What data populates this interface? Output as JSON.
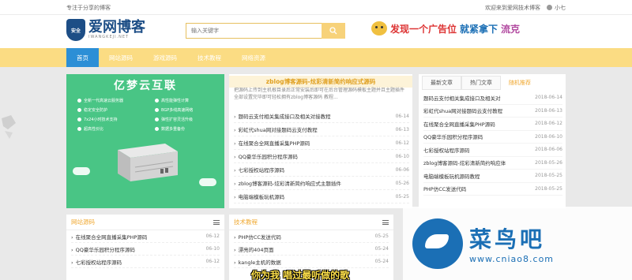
{
  "topbar": {
    "tagline": "专注于分享的博客",
    "welcome": "欢迎来到爱网技术博客",
    "user": "小七"
  },
  "logo": {
    "badge": "安全",
    "name": "爱网博客",
    "sub": "IWANGKEJI.NET"
  },
  "search": {
    "placeholder": "输入关键字"
  },
  "ad": {
    "text1": "发现一个广告位",
    "text2": "就紧拿下",
    "text3": "流克"
  },
  "nav": [
    {
      "label": "首页",
      "active": true
    },
    {
      "label": "网站源码",
      "active": false
    },
    {
      "label": "游戏源码",
      "active": false
    },
    {
      "label": "技术教程",
      "active": false
    },
    {
      "label": "网络资源",
      "active": false
    }
  ],
  "banner": {
    "title": "亿梦云互联",
    "features": [
      "全新一代高速云服务器",
      "高性能弹性计算",
      "稳定安全防护",
      "BGP多线高速网络",
      "7x24小时技术支持",
      "弹性扩容灵活升级",
      "超高性价比",
      "数据多重备份"
    ]
  },
  "center": {
    "headline": "zblog博客源码-炫彩清新简约响应式源码",
    "summary": "把源码上传到主机根目录后正常安装后即可在后台管理源码模板主题并且主题插件全部设置完毕即可轻松拥有zblog博客源码 教程...",
    "items": [
      {
        "title": "题码云支付相关集成接口及相关对接教程",
        "date": "06-14"
      },
      {
        "title": "彩虹代shua网对接题码云支付教程",
        "date": "06-13"
      },
      {
        "title": "在线聚合全网直播采集PHP源码",
        "date": "06-12"
      },
      {
        "title": "QQ豪华乐园积分程序源码",
        "date": "06-10"
      },
      {
        "title": "七彩授权站程序源码",
        "date": "06-06"
      },
      {
        "title": "zblog博客源码-炫彩清新简约响应式主题插件",
        "date": "05-26"
      },
      {
        "title": "电脑端模板玩机源码",
        "date": "05-25"
      }
    ]
  },
  "side": {
    "tabs": [
      "最新文章",
      "热门文章",
      "随机推荐"
    ],
    "items": [
      {
        "title": "题码云支付相关集成接口及相关对",
        "date": "2018-06-14"
      },
      {
        "title": "彩虹代shua网对接题码云支付教程",
        "date": "2018-06-13"
      },
      {
        "title": "在线聚合全网直播采集PHP源码",
        "date": "2018-06-12"
      },
      {
        "title": "QQ豪华乐园积分程序源码",
        "date": "2018-06-10"
      },
      {
        "title": "七彩授权站程序源码",
        "date": "2018-06-06"
      },
      {
        "title": "zblog博客源码-炫彩清新简约响应体",
        "date": "2018-05-26"
      },
      {
        "title": "电脑端模板玩机源码教程",
        "date": "2018-05-25"
      },
      {
        "title": "PHP仿CC发送代码",
        "date": "2018-05-25"
      }
    ]
  },
  "boxes": [
    {
      "title": "网站源码",
      "items": [
        {
          "title": "在线聚合全网直播采集PHP源码",
          "date": "06-12"
        },
        {
          "title": "QQ豪华乐园积分程序源码",
          "date": "06-10"
        },
        {
          "title": "七彩授权站程序源码",
          "date": "06-12"
        }
      ]
    },
    {
      "title": "技术教程",
      "items": [
        {
          "title": "PHP仿CC发送代码",
          "date": "05-25"
        },
        {
          "title": "漂亮的404页面",
          "date": "05-24"
        },
        {
          "title": "kangle主机的数据",
          "date": "05-24"
        }
      ]
    }
  ],
  "watermark": {
    "title": "菜鸟吧",
    "url": "www.cniao8.com"
  },
  "subtitle": "你为我 唱过最听做的歌",
  "colors": {
    "nav": "#fbdc83",
    "active": "#2c8fd6",
    "accent": "#f0a830",
    "banner": "#49c585"
  }
}
